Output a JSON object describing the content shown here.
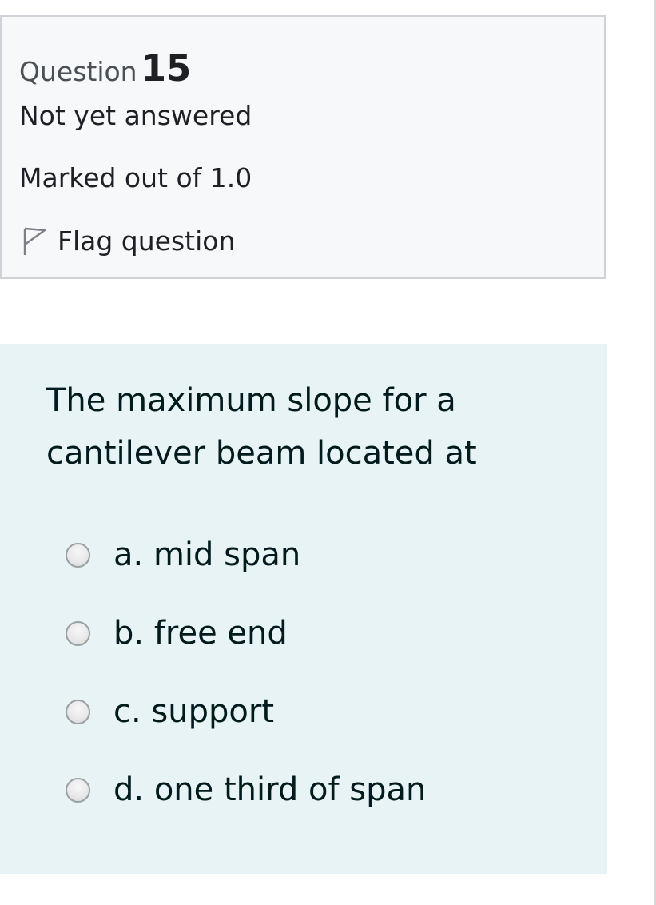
{
  "question_info": {
    "question_word": "Question",
    "question_number": "15",
    "state": "Not yet answered",
    "grade": "Marked out of 1.0",
    "flag_label": "Flag question",
    "flag_icon": "flag-outline-icon"
  },
  "question": {
    "text": "The maximum slope for a cantilever beam located at",
    "answers": [
      {
        "label": "a. mid span",
        "selected": false
      },
      {
        "label": "b. free end",
        "selected": false
      },
      {
        "label": "c. support",
        "selected": false
      },
      {
        "label": "d. one third of span",
        "selected": false
      }
    ]
  },
  "colors": {
    "info_background": "#f7f8fa",
    "info_border": "#cfd3d7",
    "content_background": "#e7f3f5",
    "text": "#1d2125"
  }
}
